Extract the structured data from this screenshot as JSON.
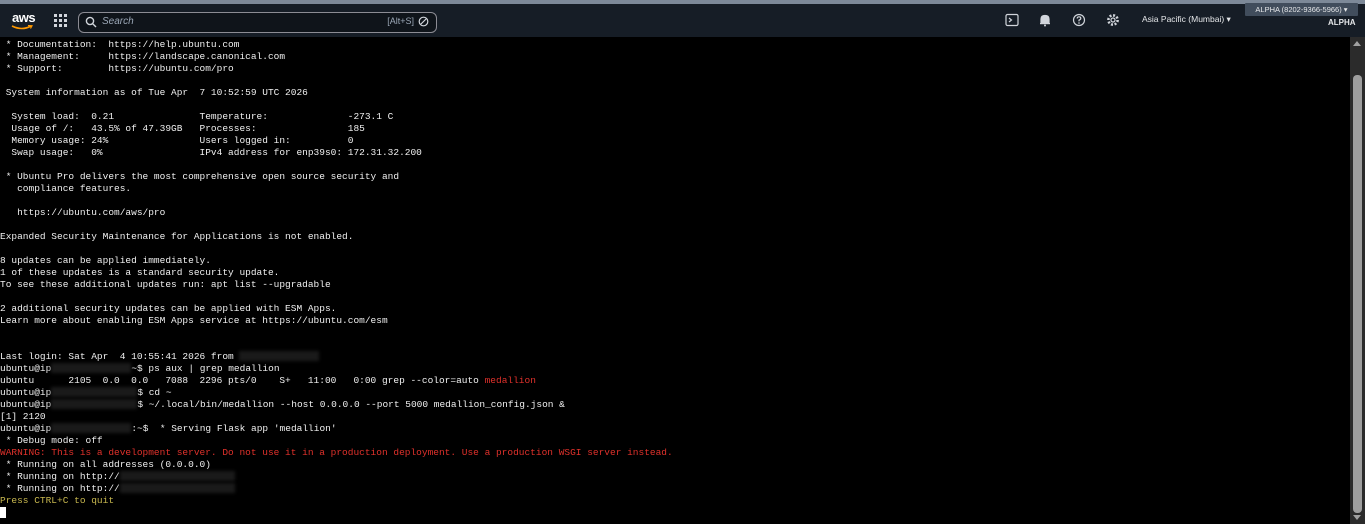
{
  "navbar": {
    "logo_text": "aws",
    "search": {
      "placeholder": "Search",
      "shortcut": "[Alt+S]"
    },
    "icons": [
      "cloudshell-icon",
      "bell-icon",
      "help-icon",
      "gear-icon"
    ],
    "region": "Asia Pacific (Mumbai) ▾",
    "account_badge": "ALPHA (8202-9366-5966) ▾",
    "account_name": "ALPHA"
  },
  "terminal": {
    "lines": [
      {
        "text": " * Documentation:  https://help.ubuntu.com"
      },
      {
        "text": " * Management:     https://landscape.canonical.com"
      },
      {
        "text": " * Support:        https://ubuntu.com/pro"
      },
      {
        "text": ""
      },
      {
        "text": " System information as of Tue Apr  7 10:52:59 UTC 2026"
      },
      {
        "text": ""
      },
      {
        "text": "  System load:  0.21               Temperature:              -273.1 C"
      },
      {
        "text": "  Usage of /:   43.5% of 47.39GB   Processes:                185"
      },
      {
        "text": "  Memory usage: 24%                Users logged in:          0"
      },
      {
        "text": "  Swap usage:   0%                 IPv4 address for enp39s0: 172.31.32.200"
      },
      {
        "text": ""
      },
      {
        "text": " * Ubuntu Pro delivers the most comprehensive open source security and"
      },
      {
        "text": "   compliance features."
      },
      {
        "text": ""
      },
      {
        "text": "   https://ubuntu.com/aws/pro"
      },
      {
        "text": ""
      },
      {
        "text": "Expanded Security Maintenance for Applications is not enabled."
      },
      {
        "text": ""
      },
      {
        "text": "8 updates can be applied immediately."
      },
      {
        "text": "1 of these updates is a standard security update."
      },
      {
        "text": "To see these additional updates run: apt list --upgradable"
      },
      {
        "text": ""
      },
      {
        "text": "2 additional security updates can be applied with ESM Apps."
      },
      {
        "text": "Learn more about enabling ESM Apps service at https://ubuntu.com/esm"
      },
      {
        "text": ""
      },
      {
        "text": ""
      },
      {
        "text": "Last login: Sat Apr  4 10:55:41 2026 from ",
        "blur": 80
      },
      {
        "text": "ubuntu@ip",
        "blur": 80,
        "after": "~$ ps aux | grep medallion"
      },
      {
        "text": "ubuntu      2105  0.0  0.0   7088  2296 pts/0    S+   11:00   0:00 grep --color=auto ",
        "red_suffix": "medallion"
      },
      {
        "text": "ubuntu@ip",
        "blur": 86,
        "after": "$ cd ~"
      },
      {
        "text": "ubuntu@ip",
        "blur": 86,
        "after": "$ ~/.local/bin/medallion --host 0.0.0.0 --port 5000 medallion_config.json &"
      },
      {
        "text": "[1] 2120"
      },
      {
        "text": "ubuntu@ip",
        "blur": 80,
        "after": ":~$  * Serving Flask app 'medallion'"
      },
      {
        "text": " * Debug mode: off"
      },
      {
        "text": "WARNING: This is a development server. Do not use it in a production deployment. Use a production WSGI server instead.",
        "style": "red"
      },
      {
        "text": " * Running on all addresses (0.0.0.0)"
      },
      {
        "text": " * Running on http://",
        "blur": 115
      },
      {
        "text": " * Running on http://",
        "blur": 115
      },
      {
        "text": "Press CTRL+C to quit",
        "style": "yellow"
      },
      {
        "text": "",
        "cursor": true
      }
    ]
  }
}
